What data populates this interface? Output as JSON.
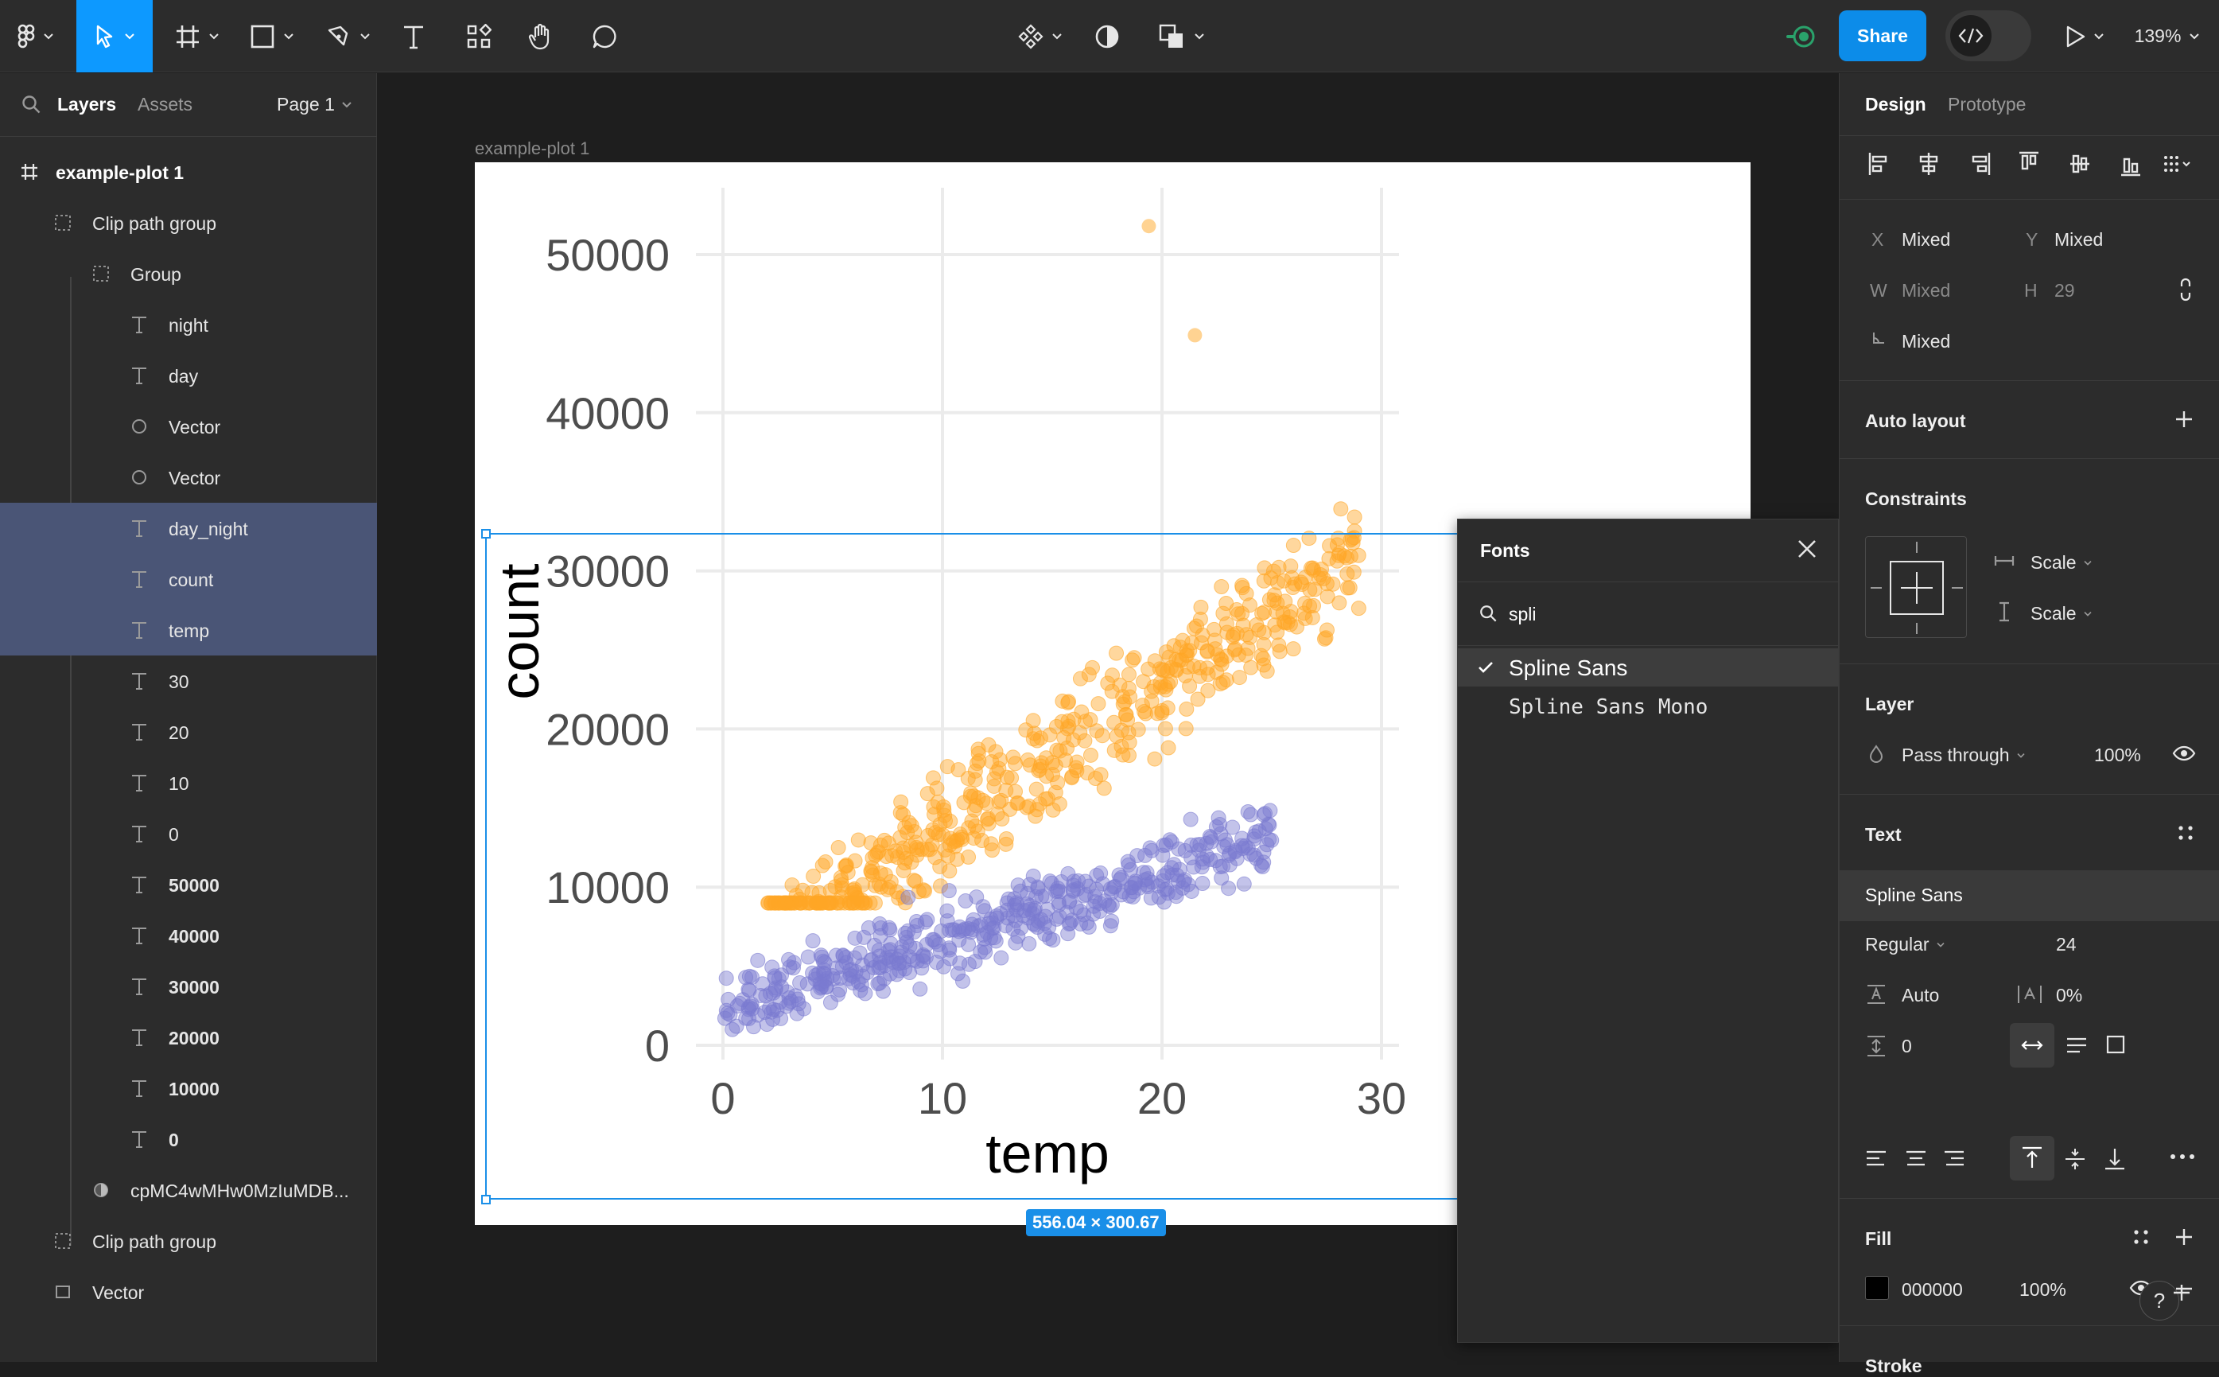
{
  "toolbar": {
    "share_label": "Share",
    "zoom": "139%"
  },
  "left_panel": {
    "tabs": [
      "Layers",
      "Assets"
    ],
    "page": "Page 1",
    "layers": [
      {
        "label": "example-plot 1",
        "icon": "frame-icon"
      },
      {
        "label": "Clip path group",
        "icon": "group-dashed-icon"
      },
      {
        "label": "Group",
        "icon": "group-dashed-icon"
      },
      {
        "label": "night",
        "icon": "text-icon"
      },
      {
        "label": "day",
        "icon": "text-icon"
      },
      {
        "label": "Vector",
        "icon": "ellipse-icon"
      },
      {
        "label": "Vector",
        "icon": "ellipse-icon"
      },
      {
        "label": "day_night",
        "icon": "text-icon"
      },
      {
        "label": "count",
        "icon": "text-icon"
      },
      {
        "label": "temp",
        "icon": "text-icon"
      },
      {
        "label": "30",
        "icon": "text-icon"
      },
      {
        "label": "20",
        "icon": "text-icon"
      },
      {
        "label": "10",
        "icon": "text-icon"
      },
      {
        "label": "0",
        "icon": "text-icon"
      },
      {
        "label": "50000",
        "icon": "text-icon"
      },
      {
        "label": "40000",
        "icon": "text-icon"
      },
      {
        "label": "30000",
        "icon": "text-icon"
      },
      {
        "label": "20000",
        "icon": "text-icon"
      },
      {
        "label": "10000",
        "icon": "text-icon"
      },
      {
        "label": "0",
        "icon": "text-icon"
      },
      {
        "label": "cpMC4wMHw0MzIuMDB...",
        "icon": "image-fill-icon"
      },
      {
        "label": "Clip path group",
        "icon": "group-dashed-icon"
      },
      {
        "label": "Vector",
        "icon": "rectangle-icon"
      }
    ]
  },
  "canvas": {
    "frame_label": "example-plot 1",
    "selection_size": "556.04 × 300.67"
  },
  "plot": {
    "y_ticks": [
      "50000",
      "40000",
      "30000",
      "20000",
      "10000",
      "0"
    ],
    "x_ticks": [
      "0",
      "10",
      "20",
      "30"
    ],
    "xlabel": "temp",
    "ylabel": "count",
    "series_colors": {
      "day": "#ffa726",
      "night": "#7b7bd0"
    }
  },
  "fonts_popup": {
    "title": "Fonts",
    "search": "spli",
    "results": [
      "Spline Sans",
      "Spline Sans Mono"
    ]
  },
  "right_panel": {
    "tabs": [
      "Design",
      "Prototype"
    ],
    "x_label": "X",
    "x_value": "Mixed",
    "y_label": "Y",
    "y_value": "Mixed",
    "w_label": "W",
    "w_value": "Mixed",
    "h_label": "H",
    "h_value": "29",
    "rotation_value": "Mixed",
    "auto_layout": "Auto layout",
    "constraints": "Constraints",
    "constraint_h": "Scale",
    "constraint_v": "Scale",
    "layer": "Layer",
    "blend": "Pass through",
    "opacity": "100%",
    "text": "Text",
    "font_name": "Spline Sans",
    "font_style": "Regular",
    "font_size": "24",
    "line_height": "Auto",
    "letter_spacing": "0%",
    "paragraph_spacing": "0",
    "fill": "Fill",
    "fill_hex": "000000",
    "fill_opacity": "100%",
    "stroke": "Stroke",
    "help": "?"
  }
}
